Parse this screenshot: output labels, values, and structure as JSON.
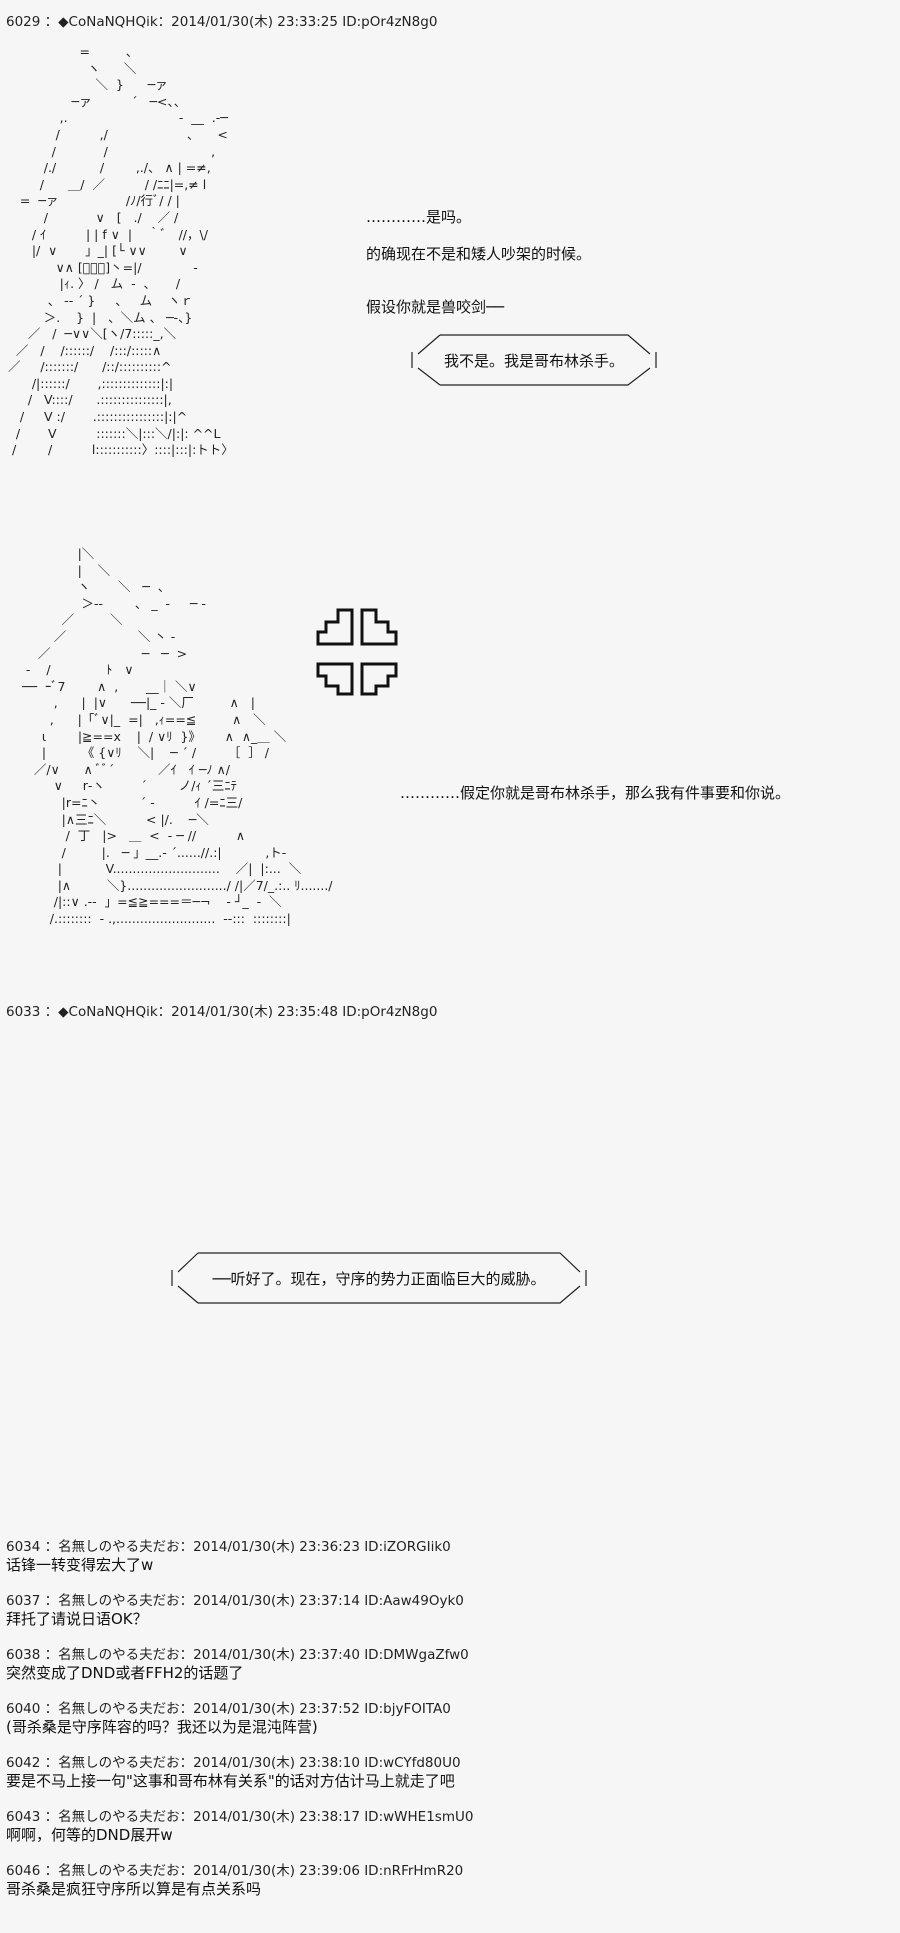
{
  "post1": {
    "header": "6029 ：◆CoNaNQHQik：2014/01/30(木) 23:33:25 ID:pOr4zN8g0",
    "aa": "                   =         、\n                     ヽ      ＼\n                       ＼  }      ─ァ\n                 ─ァ          ´   ─<、、\n              ,.                            -  __  .-─\n             /          ,/                    ､      <\n            /            /                          ,\n          /./           /        ,./、 ∧ | =≠,\n         /      ＿/  ／          / /ﾆﾆ|=,≠ l\n    =  ─ァ                 /ﾉ/行ﾞ/ / |\n          /            ∨   [   ./    ／ /\n       / ｲ          | | f ∨  |    ｀ﾞ   //，\\/\n       |/  ∨       」_| [└ ∨∨        ∨\n             ∨∧ [ﾟ｡ﾟ]丶=|/             -\n              |ｨ. 〉 /   ム  -  、     /\n           、 -‐ ´ }     、   ム    ヽｒ\n          ＞.    }  |   、＼ム 、 ─-、}\n      ／   /  ─∨∨＼[ヽ/7:::::_,＼\n   ／   /    /::::::/    /:::/:::::∧\n ／     /:::::::/      /::/::::::::::^\n       /|::::::/       ,::::::::::::::|:|\n      /   V::::/      .:::::::::::::::|,\n    /     V :/       .::::::::::::::::|:|^\n   /       V          :::::::＼|:::＼/|:|: ^^L\n  /        /          l:::::::::::〉::::|:::|:トト〉",
    "narration": [
      "…………是吗。",
      "的确现在不是和矮人吵架的时候。",
      "假设你就是兽咬剑──"
    ],
    "bubble": "我不是。我是哥布林杀手。"
  },
  "post2": {
    "aa": "                |＼\n                |    ＼\n                ヽ       ＼   ─  、\n                 ＞‐‐        、 _  ‐     ─ -\n            ／         ＼\n          ／                  ＼ 丶 ‐\n      ／                       ─   ─  >\n   -    /              ﾄ   ∨\n  ──  ｰﾞ7        ∧  ,       __｜ ＼∨\n          ,      |  |∨      ──|_ ‐ ＼厂         ∧   |\n         ,      |「ﾞ∨|_  =|   ,ｨ==≦         ∧   ＼\n       ι        |≧==x    |  / ∨ﾘ  }》      ∧  ∧_＿ ＼\n       |         《 {∨ﾘ    ＼|    ─ ´ /        ［  ］ /\n     ／/∨      ∧ ﾞﾞ´           ／ｲ   ｲ ─ﾉ ∧/\n          ∨     r‐ヽ         ´        ノ/ｨ ´三ﾆﾃ\n            |r=ﾆ丶          ´ ‐          ｲ /=ﾆ三/\n            |∧三ﾆ＼          < |/.    ─＼\n             /  丁   |>   ＿  <  - ─ //          ∧\n            /         |.   ─ 」__.- ´......//.:|           ,ト-\n           |           V...........................    ／|  |:...  ＼\n           |∧         ＼}........................./ /|／7/_.:.. ﾘ......./\n          /|::∨ .-‐  」=≦≧===＝─¬    ‐ ┘_  ‐  ＼\n         /.::::::::  ‐ .,.........................  ‐‐:::  ::::::::|",
    "narration": "…………假定你就是哥布林杀手，那么我有件事要和你说。"
  },
  "post3": {
    "header": "6033 ：◆CoNaNQHQik：2014/01/30(木) 23:35:48 ID:pOr4zN8g0",
    "bubble": "──听好了。现在，守序的势力正面临巨大的威胁。"
  },
  "comments": [
    {
      "header": "6034 ：名無しのやる夫だお：2014/01/30(木) 23:36:23 ID:iZORGIik0",
      "body": "话锋一转变得宏大了w"
    },
    {
      "header": "6037 ：名無しのやる夫だお：2014/01/30(木) 23:37:14 ID:Aaw49Oyk0",
      "body": "拜托了请说日语OK？"
    },
    {
      "header": "6038 ：名無しのやる夫だお：2014/01/30(木) 23:37:40 ID:DMWgaZfw0",
      "body": "突然变成了DND或者FFH2的话题了"
    },
    {
      "header": "6040 ：名無しのやる夫だお：2014/01/30(木) 23:37:52 ID:bjyFOITA0",
      "body": "(哥杀桑是守序阵容的吗？我还以为是混沌阵营)"
    },
    {
      "header": "6042 ：名無しのやる夫だお：2014/01/30(木) 23:38:10 ID:wCYfd80U0",
      "body": "要是不马上接一句\"这事和哥布林有关系\"的话对方估计马上就走了吧"
    },
    {
      "header": "6043 ：名無しのやる夫だお：2014/01/30(木) 23:38:17 ID:wWHE1smU0",
      "body": "啊啊，何等的DND展开w"
    },
    {
      "header": "6046 ：名無しのやる夫だお：2014/01/30(木) 23:39:06 ID:nRFrHmR20",
      "body": "哥杀桑是疯狂守序所以算是有点关系吗"
    }
  ]
}
